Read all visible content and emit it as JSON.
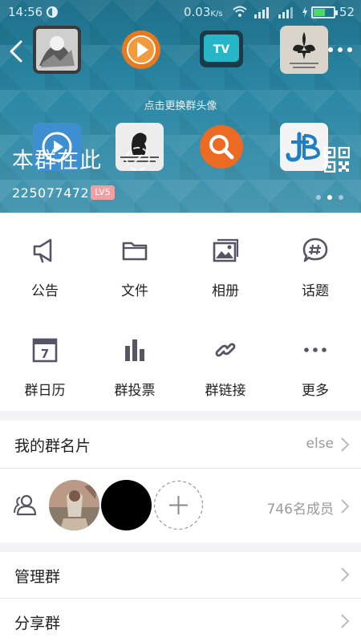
{
  "status_bar": {
    "time": "14:56",
    "speed": "0.03",
    "speed_unit": "K/s",
    "battery": "52"
  },
  "header": {
    "hint": "点击更换群头像",
    "group_name": "本群在此",
    "group_id": "225077472",
    "level_badge": "LV5"
  },
  "grid": [
    {
      "label": "公告",
      "icon": "megaphone-icon"
    },
    {
      "label": "文件",
      "icon": "folder-icon"
    },
    {
      "label": "相册",
      "icon": "album-icon"
    },
    {
      "label": "话题",
      "icon": "topic-icon"
    },
    {
      "label": "群日历",
      "icon": "calendar-icon"
    },
    {
      "label": "群投票",
      "icon": "vote-icon"
    },
    {
      "label": "群链接",
      "icon": "link-icon"
    },
    {
      "label": "更多",
      "icon": "more-icon"
    }
  ],
  "calendar_day": "7",
  "card": {
    "label": "我的群名片",
    "value": "else"
  },
  "members": {
    "count_label": "746名成员"
  },
  "menu": [
    {
      "label": "管理群"
    },
    {
      "label": "分享群"
    }
  ],
  "colors": {
    "header": "#2b88a5",
    "icon": "#555566",
    "badge": "#f0a0a0"
  }
}
